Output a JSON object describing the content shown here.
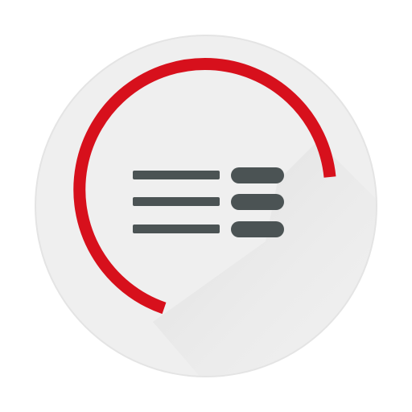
{
  "icon": {
    "name": "menu-list-app-icon",
    "colors": {
      "page_background": "#ffffff",
      "circle_fill": "#efefef",
      "circle_outer_shadow": "#e4e4e4",
      "long_shadow": "#e2e2e2",
      "arc": "#d7101c",
      "bars": "#4b5354"
    },
    "arc_sweep_fraction": 0.74,
    "menu_rows": 3
  }
}
